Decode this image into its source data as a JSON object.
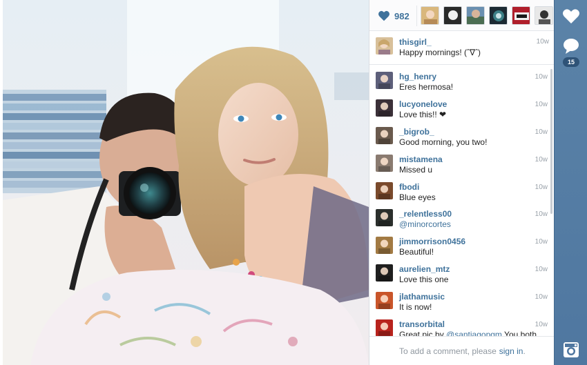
{
  "post": {
    "likes_count": "982",
    "caption": {
      "username": "thisgirl_",
      "text": "Happy mornings! (ˆ∇ˆ)",
      "time": "10w"
    }
  },
  "comments": [
    {
      "username": "hg_henry",
      "text": "Eres hermosa!",
      "time": "10w",
      "avatar_color": "#5d5f7a"
    },
    {
      "username": "lucyonelove",
      "text": "Love this!! ❤",
      "time": "10w",
      "avatar_color": "#3b3038"
    },
    {
      "username": "_bigrob_",
      "text": "Good morning, you two!",
      "time": "10w",
      "avatar_color": "#6a5a4d"
    },
    {
      "username": "mistamena",
      "text": "Missed u",
      "time": "10w",
      "avatar_color": "#8a7b70"
    },
    {
      "username": "fbodi",
      "text": "Blue eyes",
      "time": "10w",
      "avatar_color": "#7a4a2c"
    },
    {
      "username": "_relentless00",
      "text_mention": "@minorcortes",
      "time": "10w",
      "avatar_color": "#2b2f2c"
    },
    {
      "username": "jimmorrison0456",
      "text": "Beautiful!",
      "time": "10w",
      "avatar_color": "#a27a43"
    },
    {
      "username": "aurelien_mtz",
      "text": "Love this one",
      "time": "10w",
      "avatar_color": "#1f1f1f"
    },
    {
      "username": "jlathamusic",
      "text": "It is now!",
      "time": "10w",
      "avatar_color": "#c9552a"
    },
    {
      "username": "transorbital",
      "text_prefix": "Great pic by ",
      "text_mention": "@santiagopgm",
      "text_suffix": " You both",
      "time": "10w",
      "avatar_color": "#b8231d"
    }
  ],
  "add_comment": {
    "prompt": "To add a comment, please",
    "link": "sign in",
    "period": "."
  },
  "action_bar": {
    "comment_count": "15"
  },
  "colors": {
    "link_blue": "#3f729b",
    "sidebar_blue": "#517fa4"
  },
  "icons": {
    "likes": "heart-icon",
    "like_action": "heart-icon",
    "comment_action": "speech-bubble-icon",
    "app": "instagram-camera-icon"
  }
}
